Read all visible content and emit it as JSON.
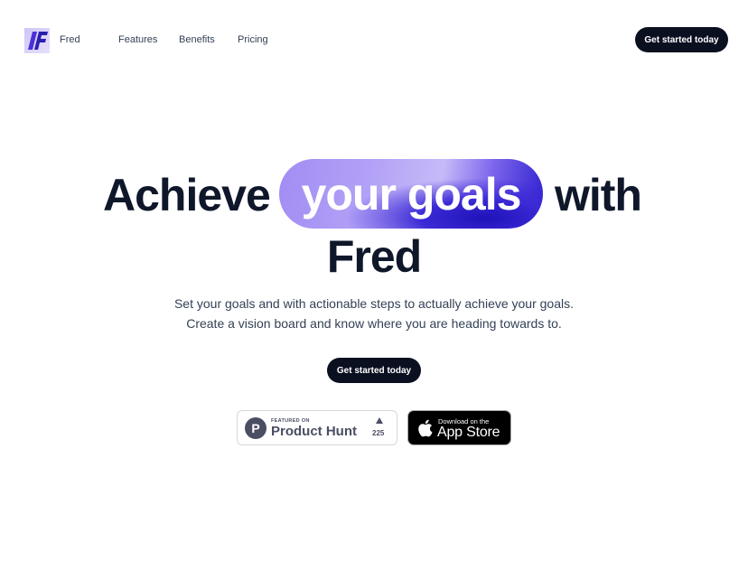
{
  "nav": {
    "brand": "Fred",
    "links": [
      "Features",
      "Benefits",
      "Pricing"
    ],
    "cta": "Get started today"
  },
  "hero": {
    "word_before": "Achieve",
    "highlight": "your goals",
    "word_after": "with",
    "line2": "Fred",
    "subtitle": "Set your goals and with actionable steps to actually achieve your goals. Create a vision board and know where you are heading towards to.",
    "cta": "Get started today"
  },
  "badges": {
    "product_hunt": {
      "featured": "FEATURED ON",
      "name": "Product Hunt",
      "count": "225"
    },
    "app_store": {
      "small": "Download on the",
      "big": "App Store"
    }
  },
  "colors": {
    "primary": "#0b1020",
    "pill_light": "#b3a2f6",
    "pill_dark": "#2d1fcf",
    "ph_gray": "#4b4e63"
  },
  "icons": [
    "fred-logo-icon",
    "product-hunt-icon",
    "upvote-arrow-icon",
    "apple-icon"
  ]
}
